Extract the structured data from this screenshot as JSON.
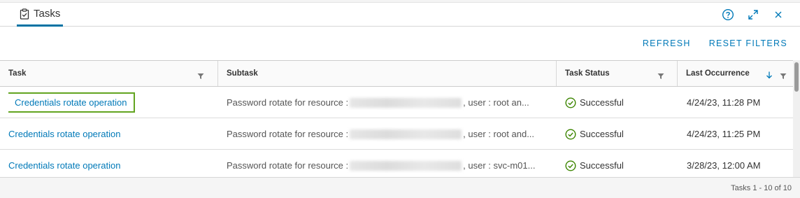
{
  "panel": {
    "tab_label": "Tasks",
    "help_icon": "help-icon",
    "expand_icon": "expand-icon",
    "close_icon": "close-icon"
  },
  "actions": {
    "refresh_label": "REFRESH",
    "reset_filters_label": "RESET FILTERS"
  },
  "grid": {
    "columns": [
      {
        "label": "Task"
      },
      {
        "label": "Subtask"
      },
      {
        "label": "Task Status"
      },
      {
        "label": "Last Occurrence"
      }
    ],
    "rows": [
      {
        "task": "Credentials rotate operation",
        "subtask_prefix": "Password rotate for resource :",
        "subtask_suffix": ", user : root an...",
        "status": "Successful",
        "last_occurrence": "4/24/23, 11:28 PM"
      },
      {
        "task": "Credentials rotate operation",
        "subtask_prefix": "Password rotate for resource :",
        "subtask_suffix": ", user : root and...",
        "status": "Successful",
        "last_occurrence": "4/24/23, 11:25 PM"
      },
      {
        "task": "Credentials rotate operation",
        "subtask_prefix": "Password rotate for resource :",
        "subtask_suffix": ", user : svc-m01...",
        "status": "Successful",
        "last_occurrence": "3/28/23, 12:00 AM"
      }
    ]
  },
  "footer": {
    "pagination_text": "Tasks 1 - 10 of 10"
  },
  "colors": {
    "accent": "#0079b8",
    "success": "#3c8500",
    "selection": "#62a420"
  }
}
